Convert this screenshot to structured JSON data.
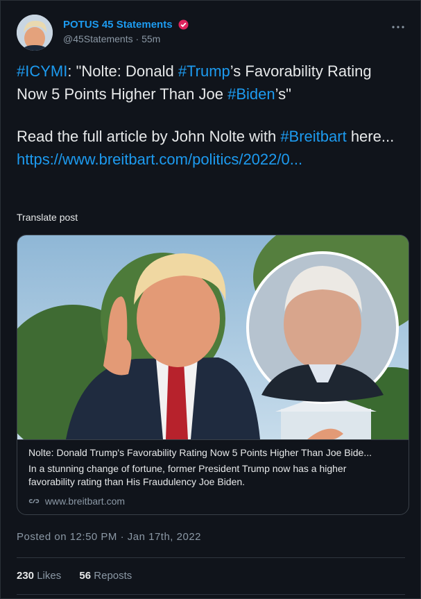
{
  "author": {
    "display_name": "POTUS 45 Statements",
    "handle": "@45Statements",
    "separator": "·",
    "time_ago": "55m"
  },
  "tweet": {
    "line1_tag": "#ICYMI",
    "line1_text": ": \"Nolte: Donald ",
    "line1_tag2": "#Trump",
    "line1_text2": "’s Favorability Rating Now 5 Points Higher Than Joe ",
    "line1_tag3": "#Biden",
    "line1_text3": "’s\"",
    "line2_text": "Read the full article by John Nolte with ",
    "line2_tag": "#Breitbart",
    "line2_text2": " here...",
    "url": "https://www.breitbart.com/politics/2022/0..."
  },
  "translate_label": "Translate post",
  "card": {
    "title": "Nolte: Donald Trump's Favorability Rating Now 5 Points Higher Than Joe Bide...",
    "description": "In a stunning change of fortune, former President Trump now has a higher favorability rating than His Fraudulency Joe Biden.",
    "domain": "www.breitbart.com"
  },
  "timestamp": "Posted on 12:50 PM · Jan 17th, 2022",
  "stats": {
    "likes_count": "230",
    "likes_label": "Likes",
    "reposts_count": "56",
    "reposts_label": "Reposts"
  },
  "colors": {
    "background": "#10141b",
    "link": "#1d9bf0",
    "muted": "#8b98a5",
    "verified": "#e0245e"
  },
  "more_icon": "ellipsis-icon"
}
